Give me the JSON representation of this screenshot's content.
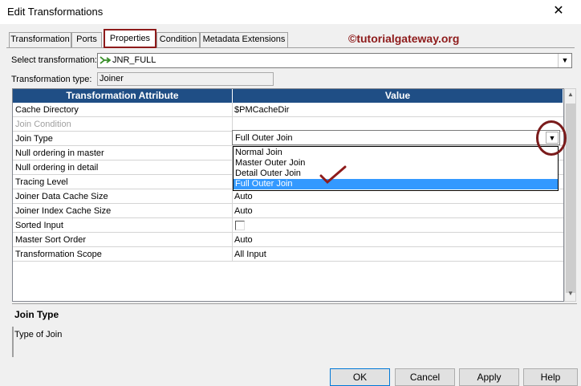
{
  "window": {
    "title": "Edit Transformations",
    "close_glyph": "✕"
  },
  "tabs": [
    {
      "label": "Transformation",
      "active": false
    },
    {
      "label": "Ports",
      "active": false
    },
    {
      "label": "Properties",
      "active": true
    },
    {
      "label": "Condition",
      "active": false
    },
    {
      "label": "Metadata Extensions",
      "active": false
    }
  ],
  "watermark": "©tutorialgateway.org",
  "select_transformation": {
    "label": "Select transformation:",
    "value": "JNR_FULL",
    "icon": "joiner-icon"
  },
  "transformation_type": {
    "label": "Transformation type:",
    "value": "Joiner"
  },
  "grid": {
    "headers": [
      "Transformation Attribute",
      "Value"
    ],
    "rows": [
      {
        "attribute": "Cache Directory",
        "value": "$PMCacheDir",
        "disabled": false
      },
      {
        "attribute": "Join Condition",
        "value": "",
        "disabled": true
      },
      {
        "attribute": "Join Type",
        "value": "Full Outer Join",
        "disabled": false
      },
      {
        "attribute": "Null ordering in master",
        "value": "",
        "disabled": false
      },
      {
        "attribute": "Null ordering in detail",
        "value": "",
        "disabled": false
      },
      {
        "attribute": "Tracing Level",
        "value": "",
        "disabled": false
      },
      {
        "attribute": "Joiner Data Cache Size",
        "value": "Auto",
        "disabled": false
      },
      {
        "attribute": "Joiner Index Cache Size",
        "value": "Auto",
        "disabled": false
      },
      {
        "attribute": "Sorted Input",
        "value": "",
        "checkbox": true,
        "checked": false
      },
      {
        "attribute": "Master Sort Order",
        "value": "Auto",
        "disabled": false
      },
      {
        "attribute": "Transformation Scope",
        "value": "All Input",
        "disabled": false
      }
    ]
  },
  "join_type_dropdown": {
    "options": [
      "Normal Join",
      "Master Outer Join",
      "Detail Outer Join",
      "Full Outer Join"
    ],
    "selected": "Full Outer Join"
  },
  "annotation": {
    "tick": "✓"
  },
  "description": {
    "title": "Join Type",
    "text": "Type of Join"
  },
  "buttons": {
    "ok": "OK",
    "cancel": "Cancel",
    "apply": "Apply",
    "help": "Help"
  },
  "colors": {
    "header_bg": "#1f4e85",
    "highlight": "#3399ff",
    "annotation": "#8e1b1b"
  }
}
